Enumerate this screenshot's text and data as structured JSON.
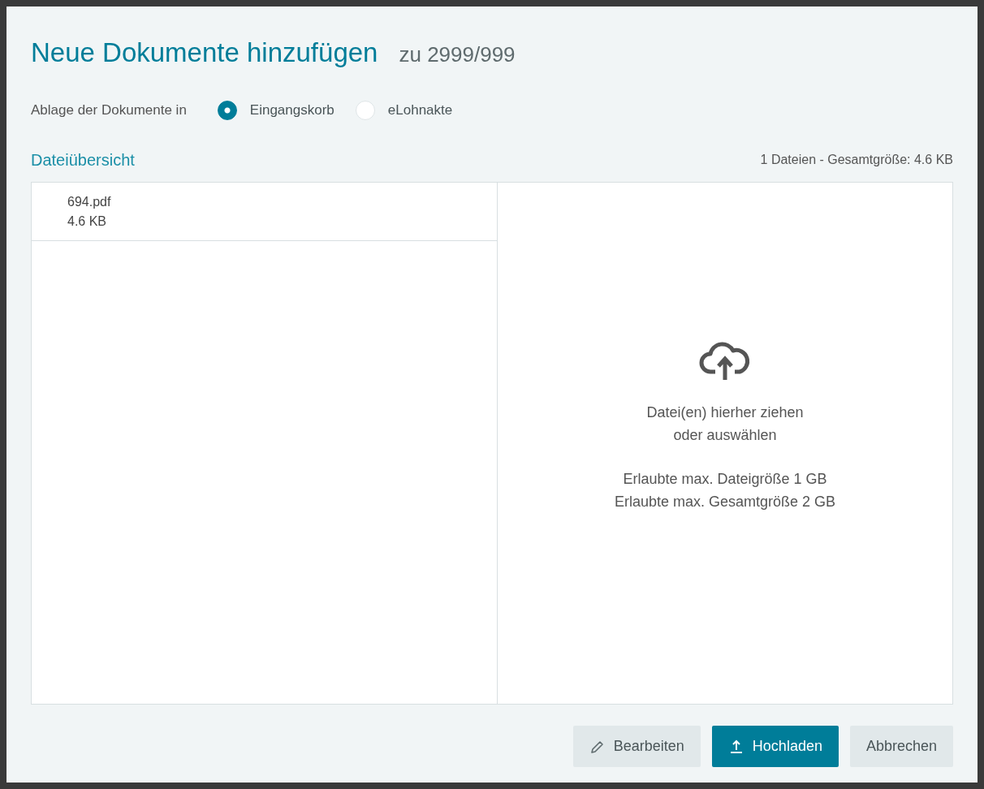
{
  "dialog": {
    "title": "Neue Dokumente hinzufügen",
    "subtitle": "zu 2999/999"
  },
  "storage": {
    "label": "Ablage der Dokumente in",
    "options": [
      {
        "label": "Eingangskorb",
        "selected": true
      },
      {
        "label": "eLohnakte",
        "selected": false
      }
    ]
  },
  "overview": {
    "title": "Dateiübersicht",
    "summary": "1 Dateien - Gesamtgröße: 4.6 KB",
    "files": [
      {
        "name": "694.pdf",
        "size": "4.6 KB"
      }
    ]
  },
  "dropzone": {
    "line1": "Datei(en) hierher ziehen",
    "line2": "oder auswählen",
    "limit1": "Erlaubte max. Dateigröße 1 GB",
    "limit2": "Erlaubte max. Gesamtgröße 2 GB"
  },
  "buttons": [
    {
      "label": "Bearbeiten",
      "kind": "edit"
    },
    {
      "label": "Hochladen",
      "kind": "upload"
    },
    {
      "label": "Abbrechen",
      "kind": "plain"
    }
  ]
}
